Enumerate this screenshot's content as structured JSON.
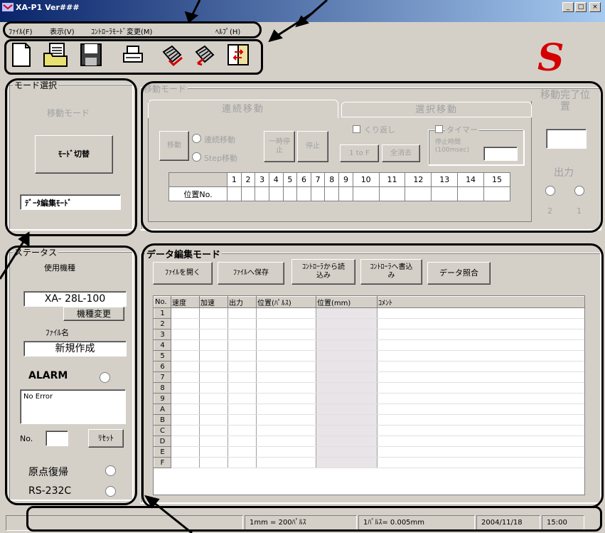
{
  "window": {
    "title": "XA-P1 Ver###",
    "minimize": "_",
    "maximize": "□",
    "close": "×"
  },
  "menu": [
    "ﾌｧｲﾙ(F)",
    "表示(V)",
    "ｺﾝﾄﾛｰﾗﾓｰﾄﾞ変更(M)",
    "ﾍﾙﾌﾟ(H)"
  ],
  "toolbar": {
    "icons": [
      "new-file-icon",
      "open-folder-icon",
      "save-disk-icon",
      "print-icon",
      "controller-read-icon",
      "controller-write-icon",
      "compare-icon"
    ]
  },
  "logo": {
    "text": "S",
    "color": "#d40000"
  },
  "mode_select": {
    "group_label": "モード選択",
    "current_mode_label": "移動モード",
    "switch_button": "ﾓｰﾄﾞ切替",
    "edit_mode_display": "ﾃﾞｰﾀ編集ﾓｰﾄﾞ"
  },
  "move_mode": {
    "group_label": "移動モード",
    "tab_continuous": "連続移動",
    "tab_select": "選択移動",
    "move_button": "移動",
    "radio_continuous": "連続移動",
    "radio_step": "Step移動",
    "pause_button": "一時停止",
    "stop_button": "停止",
    "repeat_label": "くり返し",
    "timer_label": "タイマー",
    "one_to_f_button": "1 to F",
    "clear_all_button": "全消去",
    "stop_time_label": "停止時間(100msec)",
    "position_row_label": "位置No.",
    "columns": [
      "1",
      "2",
      "3",
      "4",
      "5",
      "6",
      "7",
      "8",
      "9",
      "10",
      "11",
      "12",
      "13",
      "14",
      "15"
    ],
    "complete_label": "移動完了位置",
    "output_label": "出力",
    "output_numbers": [
      "2",
      "1"
    ]
  },
  "status": {
    "group_label": "ステータス",
    "model_label": "使用機種",
    "model_value": "XA- 28L-100",
    "change_model_button": "機種変更",
    "file_name_label": "ﾌｧｲﾙ名",
    "file_name_value": "新規作成",
    "alarm_label": "ALARM",
    "error_text": "No Error",
    "no_label": "No.",
    "reset_button": "ﾘｾｯﾄ",
    "origin_return_label": "原点復帰",
    "rs232c_label": "RS-232C"
  },
  "data_edit": {
    "group_label": "データ編集モード",
    "buttons": [
      "ﾌｧｲﾙを開く",
      "ﾌｧｲﾙへ保存",
      "ｺﾝﾄﾛｰﾗから読込み",
      "ｺﾝﾄﾛｰﾗへ書込み",
      "データ照合"
    ],
    "headers": [
      "No.",
      "速度",
      "加速",
      "出力",
      "位置(ﾊﾟﾙｽ)",
      "位置(mm)",
      "ｺﾒﾝﾄ"
    ],
    "row_numbers": [
      "1",
      "2",
      "3",
      "4",
      "5",
      "6",
      "7",
      "8",
      "9",
      "A",
      "B",
      "C",
      "D",
      "E",
      "F"
    ]
  },
  "statusbar": {
    "conversion1": "1mm = 200ﾊﾟﾙｽ",
    "conversion2": "1ﾊﾟﾙｽ= 0.005mm",
    "date": "2004/11/18",
    "time": "15:00"
  }
}
